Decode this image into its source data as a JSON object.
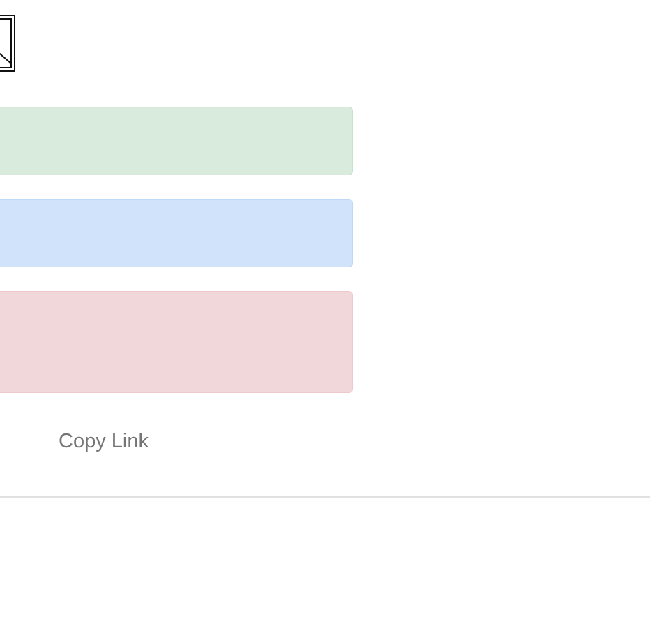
{
  "image": {
    "icon": "broken-image-icon"
  },
  "alerts": {
    "success_color": "#d8ebdd",
    "info_color": "#d0e3fa",
    "danger_color": "#f2d7da"
  },
  "links": {
    "partial_label": "nk",
    "copy_label": "Copy Link"
  }
}
